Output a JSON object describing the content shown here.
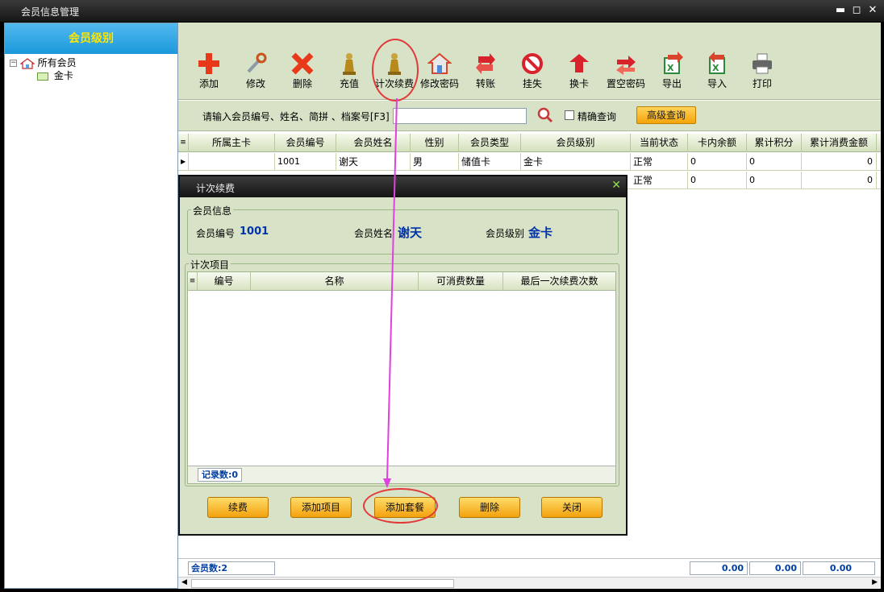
{
  "window": {
    "title": "会员信息管理",
    "minimize": "▬",
    "maximize": "◻",
    "close": "✕"
  },
  "left_panel": {
    "header": "会员级别",
    "tree": [
      {
        "label": "所有会员",
        "expander": "−"
      },
      {
        "label": "金卡"
      }
    ]
  },
  "toolbar": {
    "items": [
      {
        "label": "添加",
        "icon": "add-icon",
        "color": "#e8391b"
      },
      {
        "label": "修改",
        "icon": "wrench-icon",
        "color": "#8e9aa6"
      },
      {
        "label": "删除",
        "icon": "delete-icon",
        "color": "#e8391b"
      },
      {
        "label": "充值",
        "icon": "pawn-icon",
        "color": "#b88a1c"
      },
      {
        "label": "计次续费",
        "icon": "pawn-icon",
        "color": "#b88a1c"
      },
      {
        "label": "修改密码",
        "icon": "house-icon",
        "color": "#d8452c"
      },
      {
        "label": "转账",
        "icon": "transfer-icon",
        "color": "#d8232c"
      },
      {
        "label": "挂失",
        "icon": "forbid-icon",
        "color": "#d8232c"
      },
      {
        "label": "换卡",
        "icon": "swap-icon",
        "color": "#d8232c"
      },
      {
        "label": "置空密码",
        "icon": "reset-icon",
        "color": "#d8232c"
      },
      {
        "label": "导出",
        "icon": "excel-export-icon",
        "color": "#2a8a3a"
      },
      {
        "label": "导入",
        "icon": "excel-import-icon",
        "color": "#2a8a3a"
      },
      {
        "label": "打印",
        "icon": "printer-icon",
        "color": "#555555"
      }
    ]
  },
  "search": {
    "label": "请输入会员编号、姓名、简拼 、档案号[F3]",
    "value": "",
    "exact_label": "精确查询",
    "advanced_label": "高级查询"
  },
  "grid": {
    "columns": [
      "所属主卡",
      "会员编号",
      "会员姓名",
      "性别",
      "会员类型",
      "会员级别",
      "当前状态",
      "卡内余额",
      "累计积分",
      "累计消费金额"
    ],
    "rows": [
      {
        "main_card": "",
        "id": "1001",
        "name": "谢天",
        "gender": "男",
        "type": "储值卡",
        "level": "金卡",
        "status": "正常",
        "balance": "0",
        "points": "0",
        "total": "0"
      },
      {
        "status": "正常",
        "balance": "0",
        "points": "0",
        "total": "0"
      }
    ]
  },
  "status_bar": {
    "member_count": "会员数:2",
    "sum1": "0.00",
    "sum2": "0.00",
    "sum3": "0.00"
  },
  "dialog": {
    "title": "计次续费",
    "close": "✕",
    "member_info_legend": "会员信息",
    "member_id_label": "会员编号",
    "member_id": "1001",
    "member_name_label": "会员姓名",
    "member_name": "谢天",
    "member_level_label": "会员级别",
    "member_level": "金卡",
    "items_legend": "计次项目",
    "columns": [
      "编号",
      "名称",
      "可消费数量",
      "最后一次续费次数"
    ],
    "record_count": "记录数:0",
    "buttons": [
      "续费",
      "添加项目",
      "添加套餐",
      "删除",
      "关闭"
    ]
  },
  "colors": {
    "accent_blue": "#1b98dc",
    "header_yellow": "#ffe600",
    "annotation_red": "#e23a3a",
    "annotation_arrow": "#e040e0"
  }
}
